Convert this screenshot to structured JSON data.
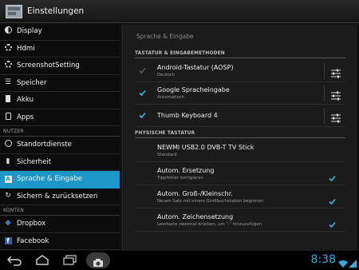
{
  "app": {
    "title": "Einstellungen",
    "icon": "settings-app-icon"
  },
  "sidebar": {
    "items": [
      {
        "label": "Display",
        "icon": "display-icon"
      },
      {
        "label": "Hdmi",
        "icon": "settings-gear-icon"
      },
      {
        "label": "ScreenshotSetting",
        "icon": "settings-gear-icon"
      },
      {
        "label": "Speicher",
        "icon": "storage-icon"
      },
      {
        "label": "Akku",
        "icon": "battery-icon"
      },
      {
        "label": "Apps",
        "icon": "apps-icon"
      }
    ],
    "header_users": "NUTZER",
    "items_users": [
      {
        "label": "Standortdienste",
        "icon": "location-icon"
      },
      {
        "label": "Sicherheit",
        "icon": "lock-icon"
      },
      {
        "label": "Sprache & Eingabe",
        "icon": "keyboard-icon",
        "active": true
      },
      {
        "label": "Sichern & zurücksetzen",
        "icon": "backup-icon"
      }
    ],
    "header_accounts": "KONTEN",
    "items_accounts": [
      {
        "label": "Dropbox",
        "icon": "dropbox-icon"
      },
      {
        "label": "Facebook",
        "icon": "facebook-icon"
      }
    ],
    "active_color": "#1d97c7"
  },
  "main": {
    "title": "Sprache & Eingabe",
    "section_keyboards": "TASTATUR & EINGABEMETHODEN",
    "keyboards": [
      {
        "label": "Android-Tastatur (AOSP)",
        "sub": "Deutsch",
        "checked": true,
        "disabled": true
      },
      {
        "label": "Google Spracheingabe",
        "sub": "Automatisch",
        "checked": true,
        "disabled": false
      },
      {
        "label": "Thumb Keyboard 4",
        "sub": "",
        "checked": true,
        "disabled": false
      }
    ],
    "section_physical": "PHYSISCHE TASTATUR",
    "physical_device": {
      "label": "NEWMI USB2.0 DVB-T TV Stick",
      "sub": "Standard"
    },
    "options": [
      {
        "label": "Autom. Ersetzung",
        "sub": "Tippfehler korrigieren",
        "checked": true
      },
      {
        "label": "Autom. Groß-/Kleinschr.",
        "sub": "Neuen Satz mit einem Großbuchstaben beginnen",
        "checked": true
      },
      {
        "label": "Autom. Zeichensetzung",
        "sub": "Leertaste zweimal drücken, um \".\" hinzuzufügen",
        "checked": true
      }
    ]
  },
  "navbar": {
    "back": "back-icon",
    "home": "home-icon",
    "recents": "recents-icon",
    "screenshot": "camera-icon",
    "time": "8:38",
    "accent": "#39a9e0"
  }
}
